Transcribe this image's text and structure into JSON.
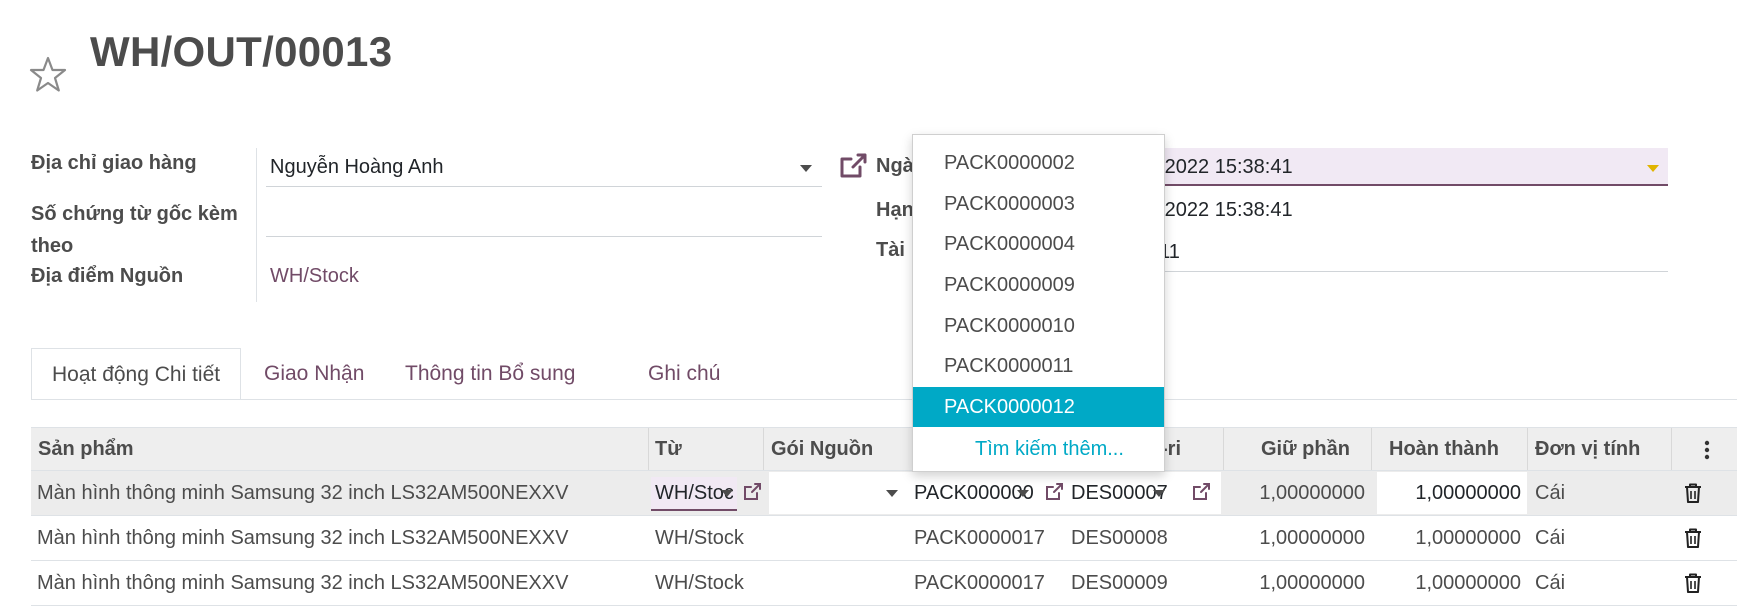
{
  "record": {
    "title": "WH/OUT/00013"
  },
  "form": {
    "delivery_address_label": "Địa chỉ giao hàng",
    "delivery_address_value": "Nguyễn Hoàng Anh",
    "source_doc_label_1": "Số chứng từ gốc kèm",
    "source_doc_label_2": "theo",
    "source_doc_value": "",
    "source_location_label": "Địa điểm Nguồn",
    "source_location_value": "WH/Stock",
    "scheduled_label": "Ngà",
    "scheduled_value": "2/2022 15:38:41",
    "deadline_label": "Hạn",
    "deadline_value": "2/2022 15:38:41",
    "doc_label": "Tài",
    "doc_value": "011"
  },
  "tabs": [
    "Hoạt động Chi tiết",
    "Giao Nhận",
    "Thông tin Bổ sung",
    "Ghi chú"
  ],
  "table": {
    "headers": {
      "product": "Sản phẩm",
      "from": "Từ",
      "source_package": "Gói Nguồn",
      "lot": "-ri",
      "reserved": "Giữ phần",
      "done": "Hoàn thành",
      "uom": "Đơn vị tính"
    },
    "rows": [
      {
        "product": "Màn hình thông minh Samsung 32 inch LS32AM500NEXXV",
        "from": "WH/Stoc",
        "source_package": "",
        "package": "PACK0000001",
        "lot": "DES00007",
        "reserved": "1,00000000",
        "done": "1,00000000",
        "uom": "Cái"
      },
      {
        "product": "Màn hình thông minh Samsung 32 inch LS32AM500NEXXV",
        "from": "WH/Stock",
        "source_package": "",
        "package": "PACK0000017",
        "lot": "DES00008",
        "reserved": "1,00000000",
        "done": "1,00000000",
        "uom": "Cái"
      },
      {
        "product": "Màn hình thông minh Samsung 32 inch LS32AM500NEXXV",
        "from": "WH/Stock",
        "source_package": "",
        "package": "PACK0000017",
        "lot": "DES00009",
        "reserved": "1,00000000",
        "done": "1,00000000",
        "uom": "Cái"
      }
    ]
  },
  "dropdown": {
    "items": [
      "PACK0000002",
      "PACK0000003",
      "PACK0000004",
      "PACK0000009",
      "PACK0000010",
      "PACK0000011",
      "PACK0000012"
    ],
    "highlighted": "PACK0000012",
    "search_more": "Tìm kiếm thêm..."
  },
  "colors": {
    "brand": "#714b67",
    "highlight": "#00a9c6",
    "header_bg": "#eeeeee"
  },
  "icons": [
    "star-icon",
    "external-link-icon",
    "caret-down-icon",
    "trash-icon",
    "kebab-icon"
  ]
}
